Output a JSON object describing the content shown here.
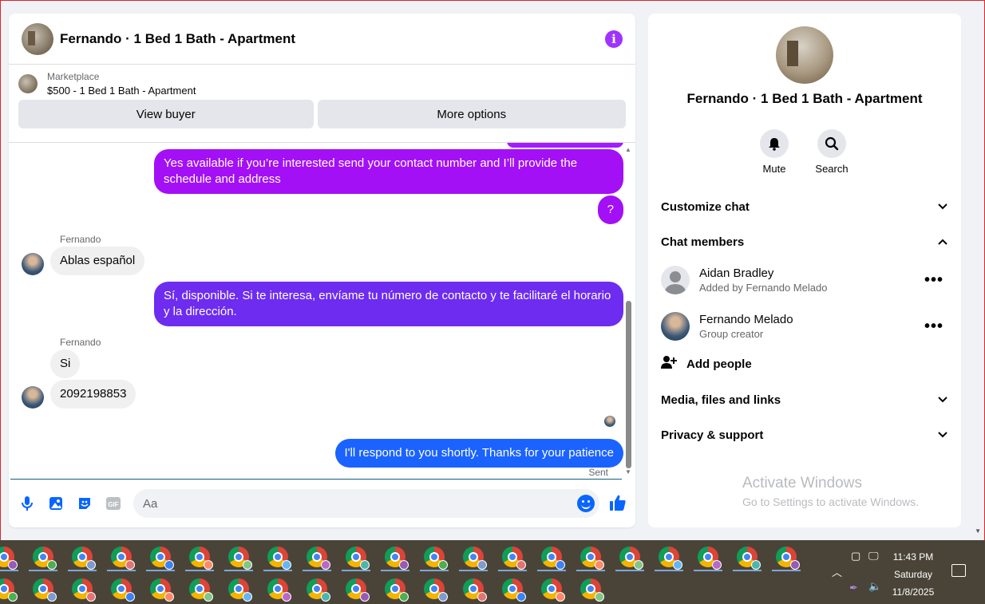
{
  "chat": {
    "title": "Fernando · 1 Bed 1 Bath - Apartment",
    "marketplace_label": "Marketplace",
    "listing": "$500 - 1 Bed 1 Bath - Apartment",
    "view_buyer": "View buyer",
    "more_options": "More options",
    "messages": [
      {
        "from": "me",
        "text": "Yes available if you’re interested send your contact number and I’ll provide the schedule and address"
      },
      {
        "from": "me",
        "text": "?"
      },
      {
        "from": "them",
        "sender": "Fernando",
        "text": "Ablas español"
      },
      {
        "from": "me",
        "text": "Sí, disponible. Si te interesa, envíame tu número de contacto y te facilitaré el horario y la dirección."
      },
      {
        "from": "them",
        "sender": "Fernando",
        "text": "Si"
      },
      {
        "from": "them",
        "text": "2092198853"
      },
      {
        "from": "me",
        "text": "I'll respond to you shortly. Thanks for your patience"
      }
    ],
    "sent_status": "Sent",
    "composer_placeholder": "Aa",
    "accent_color": "#a033ff"
  },
  "sidebar": {
    "name": "Fernando · 1 Bed 1 Bath - Apartment",
    "mute": "Mute",
    "search": "Search",
    "customize_chat": "Customize chat",
    "chat_members": "Chat members",
    "members": [
      {
        "name": "Aidan Bradley",
        "role": "Added by Fernando Melado"
      },
      {
        "name": "Fernando Melado",
        "role": "Group creator"
      }
    ],
    "add_people": "Add people",
    "media": "Media, files and links",
    "privacy": "Privacy & support"
  },
  "watermark": {
    "line1": "Activate Windows",
    "line2": "Go to Settings to activate Windows."
  },
  "taskbar": {
    "time": "11:43 PM",
    "day": "Saturday",
    "date": "11/8/2025"
  }
}
